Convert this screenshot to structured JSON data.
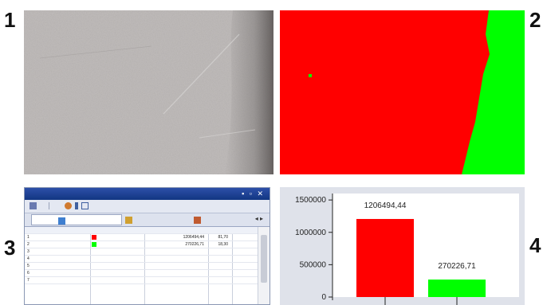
{
  "labels": {
    "p1": "1",
    "p2": "2",
    "p3": "3",
    "p4": "4"
  },
  "colors": {
    "red": "#ff0000",
    "green": "#00ff00",
    "titlebar": "#1b3f93"
  },
  "panel1": {
    "content": "grayscale micrograph texture"
  },
  "panel2": {
    "content": "segmentation map red and green regions"
  },
  "panel3": {
    "toolbar_icons": [
      "dropdown-icon",
      "separator",
      "filter-icon",
      "edit-icon",
      "grid-icon"
    ],
    "tab_icons": [
      "table-icon",
      "chart-icon",
      "image-icon"
    ],
    "rows": [
      {
        "num": "1",
        "color": "#ff0000",
        "value": "1206494,44",
        "percent": "81,70"
      },
      {
        "num": "2",
        "color": "#00ff00",
        "value": "270226,71",
        "percent": "18,30"
      },
      {
        "num": "3"
      },
      {
        "num": "4"
      },
      {
        "num": "5"
      },
      {
        "num": "6"
      },
      {
        "num": "7"
      }
    ]
  },
  "chart_data": {
    "type": "bar",
    "categories": [
      "",
      ""
    ],
    "values": [
      1206494.44,
      270226.71
    ],
    "colors": [
      "#ff0000",
      "#00ff00"
    ],
    "data_labels": [
      "1206494,44",
      "270226,71"
    ],
    "yticks": [
      "1500000",
      "1000000",
      "500000",
      "0"
    ],
    "ylim": [
      0,
      1600000
    ],
    "title": "",
    "xlabel": "",
    "ylabel": ""
  }
}
